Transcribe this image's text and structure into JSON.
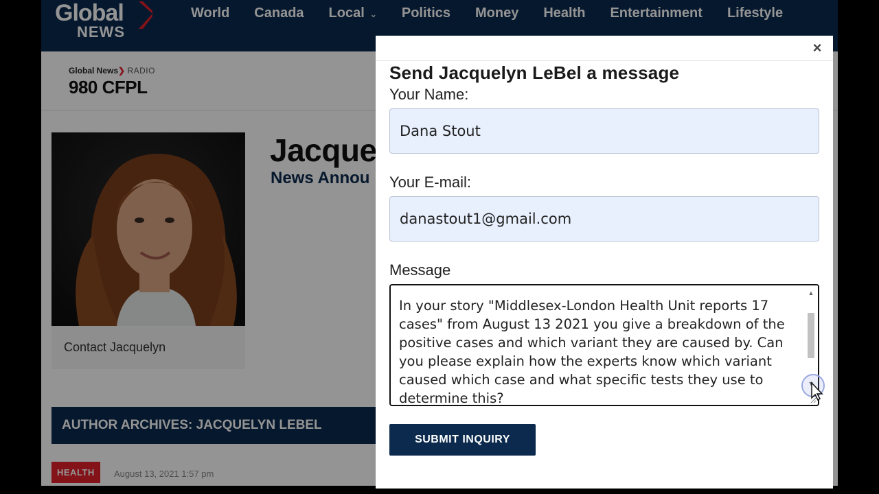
{
  "header": {
    "logo_line1": "Global",
    "logo_line2": "NEWS",
    "nav": [
      "World",
      "Canada",
      "Local",
      "Politics",
      "Money",
      "Health",
      "Entertainment",
      "Lifestyle"
    ]
  },
  "station": {
    "brand": "Global News",
    "radio": "RADIO",
    "name": "980 CFPL"
  },
  "profile": {
    "name_partial": "Jacque",
    "title_partial": "News Annou",
    "contact_label": "Contact Jacquelyn"
  },
  "archives": {
    "title": "AUTHOR ARCHIVES: JACQUELYN LEBEL",
    "tag": "HEALTH",
    "date": "August 13, 2021 1:57 pm"
  },
  "modal": {
    "close": "×",
    "title": "Send Jacquelyn LeBel a message",
    "name_label": "Your Name:",
    "name_value": "Dana Stout",
    "email_label": "Your E-mail:",
    "email_value": "danastout1@gmail.com",
    "message_label": "Message",
    "message_value": "In your story \"Middlesex-London Health Unit reports 17 cases\" from August 13 2021 you give a breakdown of the positive cases and which variant they are caused by. Can you please explain how the experts know which variant caused which case and what specific tests they use to determine this?",
    "submit_label": "SUBMIT INQUIRY"
  },
  "colors": {
    "navy": "#0b2a4e",
    "red": "#e4202b",
    "input_bg": "#e8f0fe"
  },
  "icons": {
    "close": "close-icon",
    "scroll_up": "scroll-up-icon",
    "scroll_down": "scroll-down-icon",
    "cursor": "mouse-pointer-icon"
  }
}
